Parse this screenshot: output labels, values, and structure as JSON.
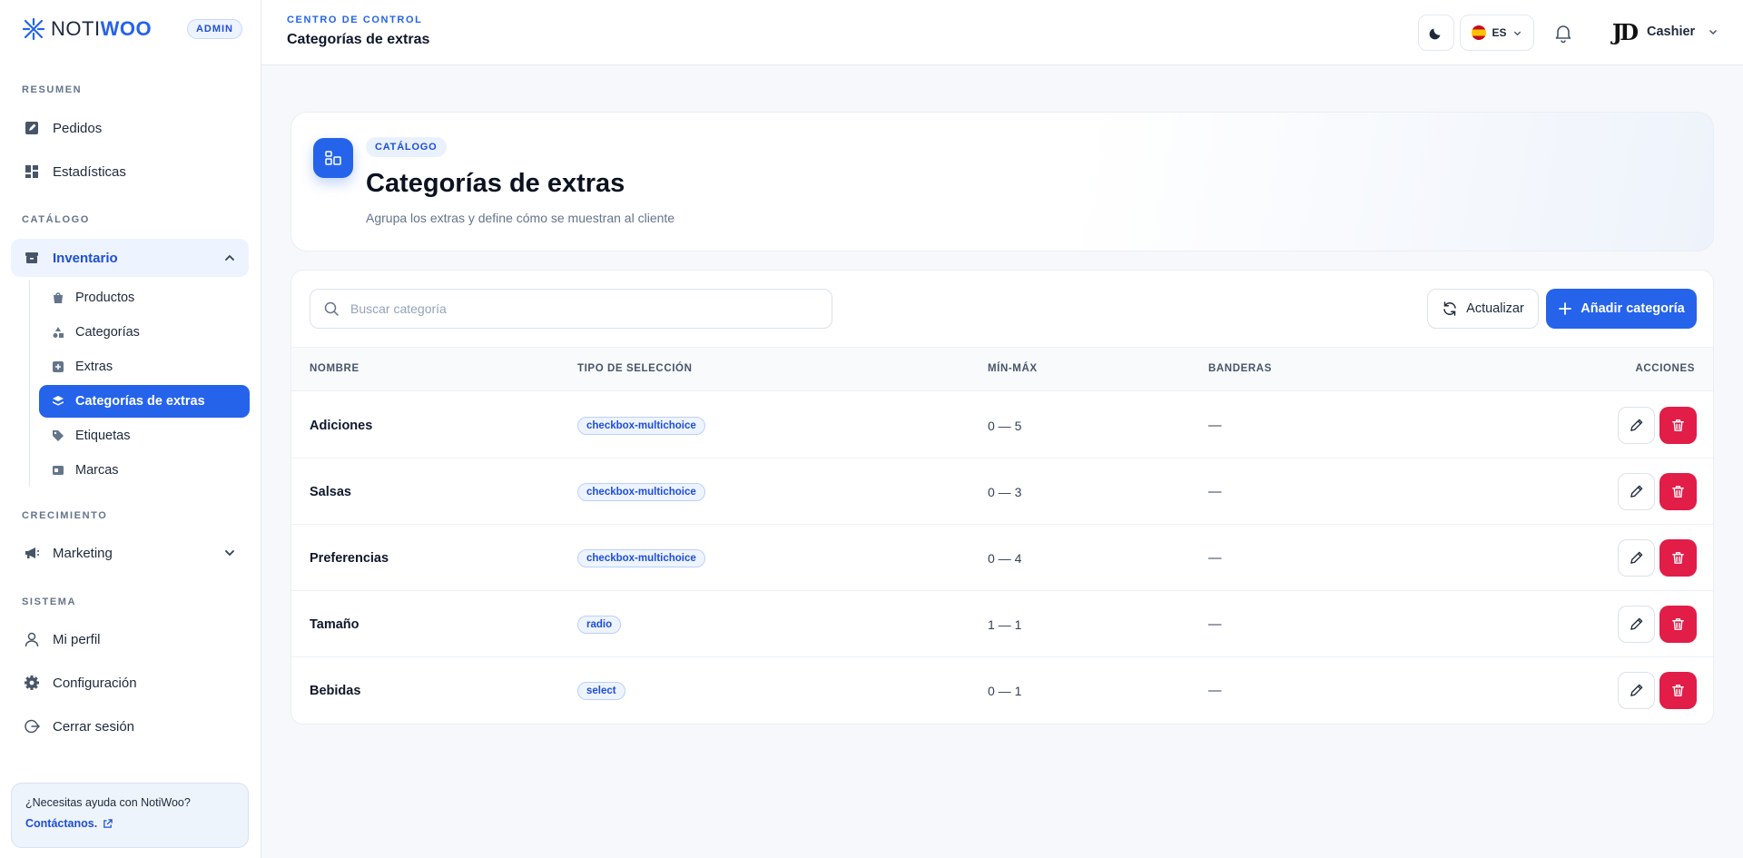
{
  "brand": {
    "name_a": "NOTI",
    "name_b": "WOO",
    "badge": "ADMIN"
  },
  "sidebar": {
    "sections": {
      "summary": "RESUMEN",
      "catalog": "CATÁLOGO",
      "growth": "CRECIMIENTO",
      "system": "SISTEMA"
    },
    "items": {
      "orders": "Pedidos",
      "stats": "Estadísticas",
      "inventory": "Inventario",
      "marketing": "Marketing",
      "profile": "Mi perfil",
      "settings": "Configuración",
      "logout": "Cerrar sesión"
    },
    "inventory_sub": {
      "products": "Productos",
      "categories": "Categorías",
      "extras": "Extras",
      "extra_categories": "Categorías de extras",
      "labels": "Etiquetas",
      "brands": "Marcas"
    },
    "help": {
      "title": "¿Necesitas ayuda con NotiWoo?",
      "link": "Contáctanos."
    }
  },
  "topbar": {
    "kicker": "CENTRO DE CONTROL",
    "title": "Categorías de extras",
    "language": "ES",
    "user": "Cashier",
    "avatar_initials": "JD"
  },
  "header": {
    "badge": "CATÁLOGO",
    "title": "Categorías de extras",
    "subtitle": "Agrupa los extras y define cómo se muestran al cliente"
  },
  "toolbar": {
    "search_placeholder": "Buscar categoría",
    "refresh_label": "Actualizar",
    "add_label": "Añadir categoría"
  },
  "table": {
    "headers": {
      "name": "NOMBRE",
      "type": "TIPO DE SELECCIÓN",
      "range": "MÍN-MÁX",
      "flags": "BANDERAS",
      "actions": "ACCIONES"
    },
    "rows": [
      {
        "name": "Adiciones",
        "type": "checkbox-multichoice",
        "range": "0 — 5",
        "flags": "—"
      },
      {
        "name": "Salsas",
        "type": "checkbox-multichoice",
        "range": "0 — 3",
        "flags": "—"
      },
      {
        "name": "Preferencias",
        "type": "checkbox-multichoice",
        "range": "0 — 4",
        "flags": "—"
      },
      {
        "name": "Tamaño",
        "type": "radio",
        "range": "1 — 1",
        "flags": "—"
      },
      {
        "name": "Bebidas",
        "type": "select",
        "range": "0 — 1",
        "flags": "—"
      }
    ]
  },
  "colors": {
    "accent": "#2563eb",
    "danger": "#e11d48"
  }
}
